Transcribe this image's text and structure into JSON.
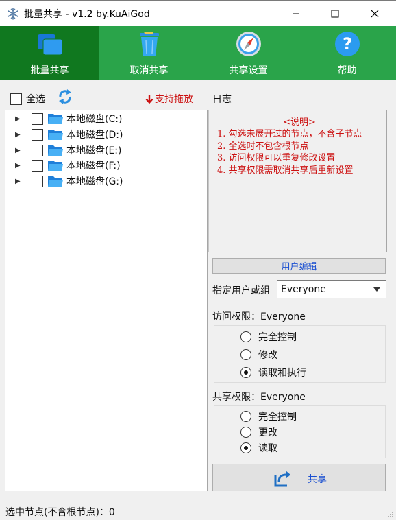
{
  "window": {
    "title": "批量共享 - v1.2 by.KuAiGod",
    "min_icon": "minimize-icon",
    "max_icon": "maximize-icon",
    "close_icon": "close-icon"
  },
  "toolbar": {
    "items": [
      {
        "label": "批量共享",
        "icon": "share-windows-icon",
        "active": true
      },
      {
        "label": "取消共享",
        "icon": "trash-bin-icon",
        "active": false
      },
      {
        "label": "共享设置",
        "icon": "compass-icon",
        "active": false
      },
      {
        "label": "帮助",
        "icon": "help-icon",
        "active": false
      }
    ],
    "bg_color": "#2aa44a",
    "active_color": "#10781f"
  },
  "tree": {
    "select_all_label": "全选",
    "drag_hint": "支持拖放",
    "drives": [
      {
        "label": "本地磁盘(C:)",
        "checked": false
      },
      {
        "label": "本地磁盘(D:)",
        "checked": false
      },
      {
        "label": "本地磁盘(E:)",
        "checked": false
      },
      {
        "label": "本地磁盘(F:)",
        "checked": false
      },
      {
        "label": "本地磁盘(G:)",
        "checked": false
      }
    ]
  },
  "log": {
    "label": "日志",
    "title": "<说明>",
    "lines": [
      "1. 勾选未展开过的节点，不含子节点",
      "2. 全选时不包含根节点",
      "3. 访问权限可以重复修改设置",
      "4. 共享权限需取消共享后重新设置"
    ],
    "text_color": "#cc1111"
  },
  "user": {
    "edit_button": "用户编辑",
    "assign_label": "指定用户或组",
    "selected": "Everyone"
  },
  "access_perm": {
    "title": "访问权限：Everyone",
    "options": [
      "完全控制",
      "修改",
      "读取和执行"
    ],
    "selected_index": 2
  },
  "share_perm": {
    "title": "共享权限：Everyone",
    "options": [
      "完全控制",
      "更改",
      "读取"
    ],
    "selected_index": 2
  },
  "share_button": {
    "label": "共享",
    "icon": "share-arrow-icon"
  },
  "status": {
    "text": "选中节点(不含根节点)：0"
  }
}
